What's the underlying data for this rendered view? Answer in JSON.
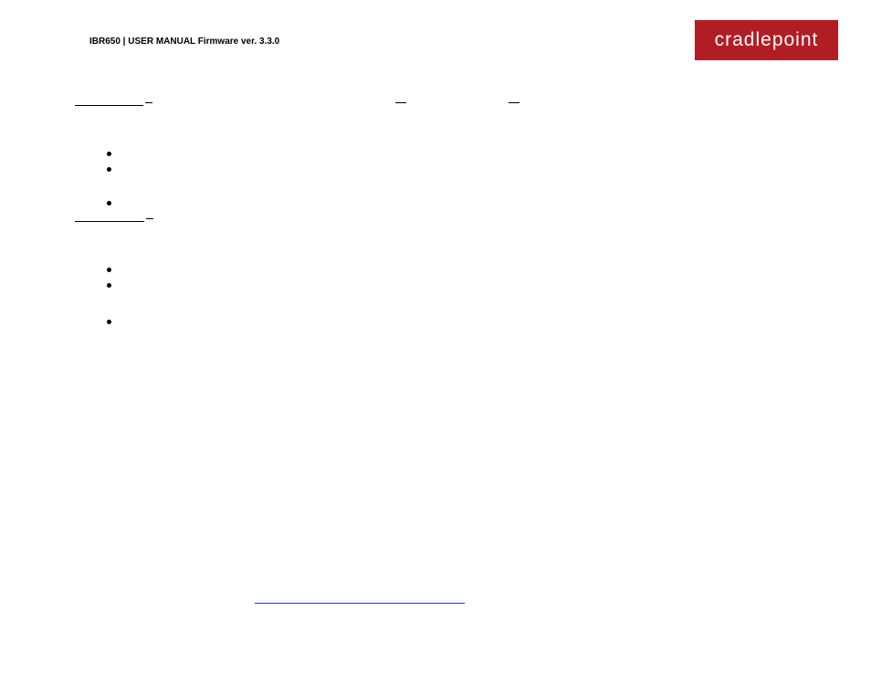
{
  "header": {
    "title": "IBR650 | USER MANUAL Firmware ver.  3.3.0"
  },
  "logo": {
    "text": "cradlepoint"
  },
  "sections": {
    "section1": {
      "title": ""
    },
    "section2": {
      "title": ""
    }
  },
  "bullets": {
    "b1": "",
    "b2": "",
    "b3": "",
    "b4": "",
    "b5": "",
    "b6": ""
  },
  "link": {
    "url": ""
  }
}
